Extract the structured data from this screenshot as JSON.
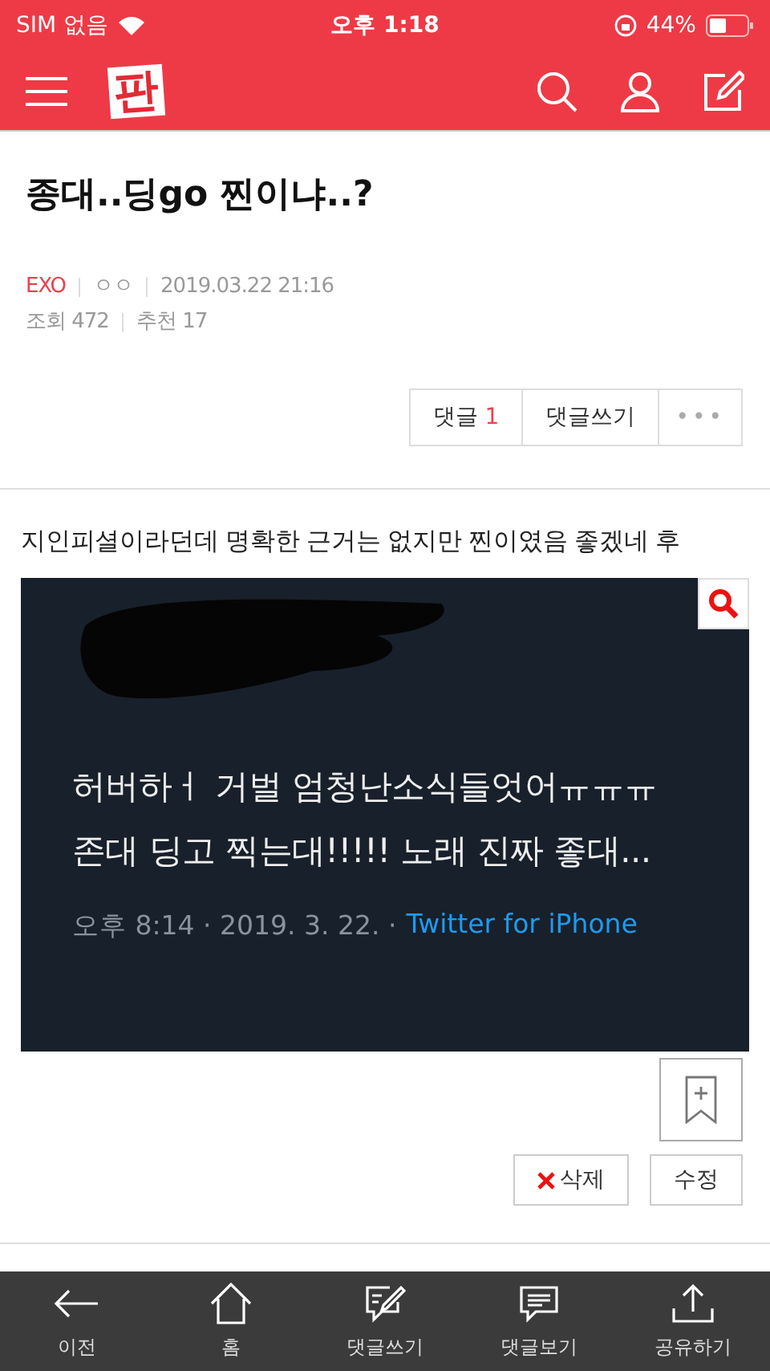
{
  "status_bar": {
    "carrier": "SIM 없음",
    "time": "오후 1:18",
    "battery": "44%"
  },
  "nav": {
    "logo": "판"
  },
  "post": {
    "title": "종대..딩go 찐이냐..?",
    "board": "EXO",
    "author": "ㅇㅇ",
    "date": "2019.03.22 21:16",
    "views": "조회 472",
    "likes": "추천 17"
  },
  "actions": [
    {
      "kind": "count",
      "label": "댓글",
      "count": "1"
    },
    {
      "kind": "plain",
      "label": "댓글쓰기"
    },
    {
      "kind": "more",
      "label": "•••"
    }
  ],
  "body": "지인피셜이라던데 명확한 근거는 없지만 찐이였음 좋겠네 후",
  "tweet": {
    "text": "허버하ㅓ 거벌 엄청난소식들엇어ㅠㅠㅠ 존대 딩고 찍는대!!!!! 노래 진짜 좋대...",
    "time": "오후 8:14 · 2019. 3. 22. ·",
    "source": "Twitter for iPhone"
  },
  "edit_buttons": [
    {
      "kind": "delete",
      "label": "삭제"
    },
    {
      "kind": "edit",
      "label": "수정"
    }
  ],
  "tab_bar": [
    {
      "kind": "back",
      "label": "이전"
    },
    {
      "kind": "home",
      "label": "홈"
    },
    {
      "kind": "write",
      "label": "댓글쓰기"
    },
    {
      "kind": "comments",
      "label": "댓글보기"
    },
    {
      "kind": "share",
      "label": "공유하기"
    }
  ]
}
